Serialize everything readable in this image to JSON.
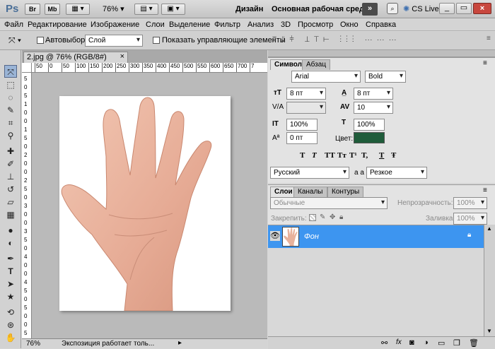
{
  "app": {
    "logo": "Ps",
    "icons": [
      "Br",
      "Mb"
    ],
    "zoom_select": "76%",
    "workspace_label": "Дизайн",
    "workspace_active": "Основная рабочая среда",
    "overflow_label": "»",
    "cs_live": "CS Live"
  },
  "menu": [
    "Файл",
    "Редактирование",
    "Изображение",
    "Слои",
    "Выделение",
    "Фильтр",
    "Анализ",
    "3D",
    "Просмотр",
    "Окно",
    "Справка"
  ],
  "options": {
    "autoselect_label": "Автовыбор:",
    "autoselect_value": "Слой",
    "show_controls_label": "Показать управляющие элементы"
  },
  "document": {
    "tab_title": "2.jpg @ 76% (RGB/8#)",
    "tab_close": "×",
    "ruler_top_labels": [
      "50",
      "0",
      "50",
      "100",
      "150",
      "200",
      "250",
      "300",
      "350",
      "400",
      "450",
      "500",
      "550",
      "600",
      "650",
      "700",
      "7"
    ],
    "ruler_left_labels": [
      "5",
      "0",
      "5",
      "1",
      "0",
      "0",
      "1",
      "5",
      "0",
      "2",
      "0",
      "0",
      "2",
      "5",
      "0",
      "3",
      "0",
      "0",
      "3",
      "5",
      "0",
      "4",
      "0",
      "0",
      "4",
      "5",
      "0",
      "5",
      "0",
      "0",
      "5"
    ],
    "status_zoom": "76%",
    "status_text": "Экспозиция работает толь..."
  },
  "character": {
    "tabs": [
      "Символ",
      "Абзац"
    ],
    "font_family": "Arial",
    "font_style": "Bold",
    "font_size": "8 пт",
    "leading": "8 пт",
    "kerning": "",
    "tracking": "10",
    "vscale": "100%",
    "hscale": "100%",
    "baseline": "0 пт",
    "color_label": "Цвет:",
    "color_value": "#1f5c3a",
    "style_buttons": [
      "T",
      "T",
      "TT",
      "Tт",
      "T¹",
      "T,",
      "T",
      "Ŧ"
    ],
    "language": "Русский",
    "aa_label": "a a",
    "antialias": "Резкое"
  },
  "layers": {
    "tabs": [
      "Слои",
      "Каналы",
      "Контуры"
    ],
    "blend_mode": "Обычные",
    "opacity_label": "Непрозрачность:",
    "opacity_value": "100%",
    "lock_label": "Закрепить:",
    "fill_label": "Заливка:",
    "fill_value": "100%",
    "items": [
      {
        "name": "Фон",
        "selected_color": "#3d95f0"
      }
    ]
  },
  "colors": {
    "accent": "#3d95f0",
    "panel_bg": "#e3e3e3"
  }
}
